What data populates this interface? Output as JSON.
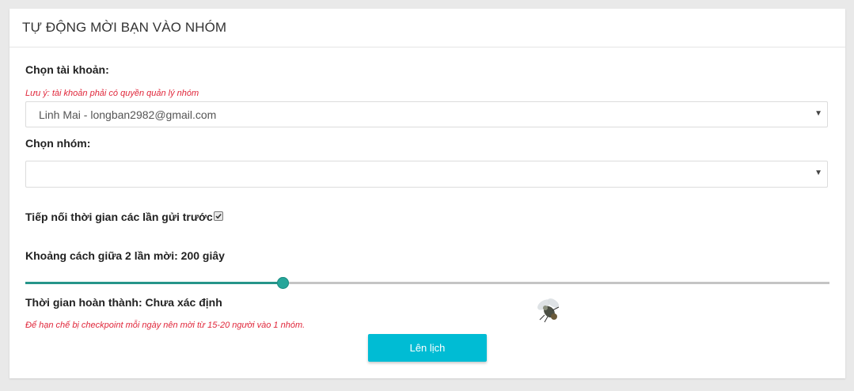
{
  "header": {
    "title": "TỰ ĐỘNG MỜI BẠN VÀO NHÓM"
  },
  "account": {
    "label": "Chọn tài khoản:",
    "note": "Lưu ý: tài khoản phải có quyền quản lý nhóm",
    "selected": "Linh Mai - longban2982@gmail.com"
  },
  "group": {
    "label": "Chọn nhóm:",
    "selected": ""
  },
  "continue_time": {
    "label": "Tiếp nối thời gian các lần gửi trước",
    "checked": true
  },
  "interval": {
    "label": "Khoảng cách giữa 2 lần mời: 200 giây",
    "slider_fraction": 0.32
  },
  "completion": {
    "label": "Thời gian hoàn thành: Chưa xác định"
  },
  "warning": "Để hạn chế bị checkpoint mỗi ngày nên mời từ 15-20 người vào 1 nhóm.",
  "schedule_button": "Lên lịch",
  "colors": {
    "accent": "#00bcd4",
    "slider": "#26a69a",
    "warning": "#e0263a"
  },
  "icons": {
    "select_caret": "caret-down-icon",
    "checkbox": "check-icon",
    "decoration": "fly-icon"
  }
}
